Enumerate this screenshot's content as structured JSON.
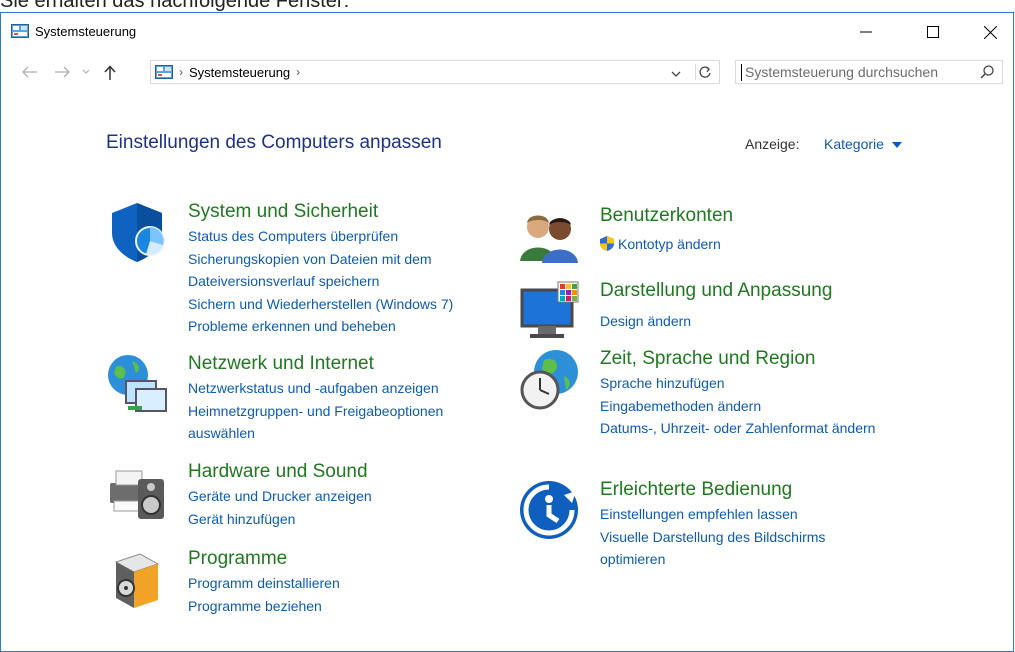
{
  "caption_top": "Sie erhalten das nachfolgende Fenster:",
  "window": {
    "title": "Systemsteuerung"
  },
  "nav": {
    "breadcrumb": "Systemsteuerung",
    "search_placeholder": "Systemsteuerung durchsuchen"
  },
  "header": {
    "heading": "Einstellungen des Computers anpassen",
    "view_label": "Anzeige:",
    "view_value": "Kategorie"
  },
  "categories": [
    {
      "title": "System und Sicherheit",
      "icon": "shield-icon",
      "links": [
        "Status des Computers überprüfen",
        "Sicherungskopien von Dateien mit dem Dateiversionsverlauf speichern",
        "Sichern und Wiederherstellen (Windows 7)",
        "Probleme erkennen und beheben"
      ]
    },
    {
      "title": "Netzwerk und Internet",
      "icon": "network-globe-icon",
      "links": [
        "Netzwerkstatus und -aufgaben anzeigen",
        "Heimnetzgruppen- und Freigabeoptionen auswählen"
      ]
    },
    {
      "title": "Hardware und Sound",
      "icon": "printer-speaker-icon",
      "links": [
        "Geräte und Drucker anzeigen",
        "Gerät hinzufügen"
      ]
    },
    {
      "title": "Programme",
      "icon": "program-box-icon",
      "links": [
        "Programm deinstallieren",
        "Programme beziehen"
      ]
    },
    {
      "title": "Benutzerkonten",
      "icon": "users-icon",
      "links": [
        "Kontotyp ändern"
      ]
    },
    {
      "title": "Darstellung und Anpassung",
      "icon": "monitor-palette-icon",
      "links": [
        "Design ändern"
      ]
    },
    {
      "title": "Zeit, Sprache und Region",
      "icon": "clock-globe-icon",
      "links": [
        "Sprache hinzufügen",
        "Eingabemethoden ändern",
        "Datums-, Uhrzeit- oder Zahlenformat ändern"
      ]
    },
    {
      "title": "Erleichterte Bedienung",
      "icon": "ease-of-access-icon",
      "links": [
        "Einstellungen empfehlen lassen",
        "Visuelle Darstellung des Bildschirms optimieren"
      ]
    }
  ],
  "colors": {
    "category_title": "#1e7a1e",
    "link": "#0c5bb5",
    "heading": "#1e3287",
    "window_border": "#2b7bd6"
  }
}
